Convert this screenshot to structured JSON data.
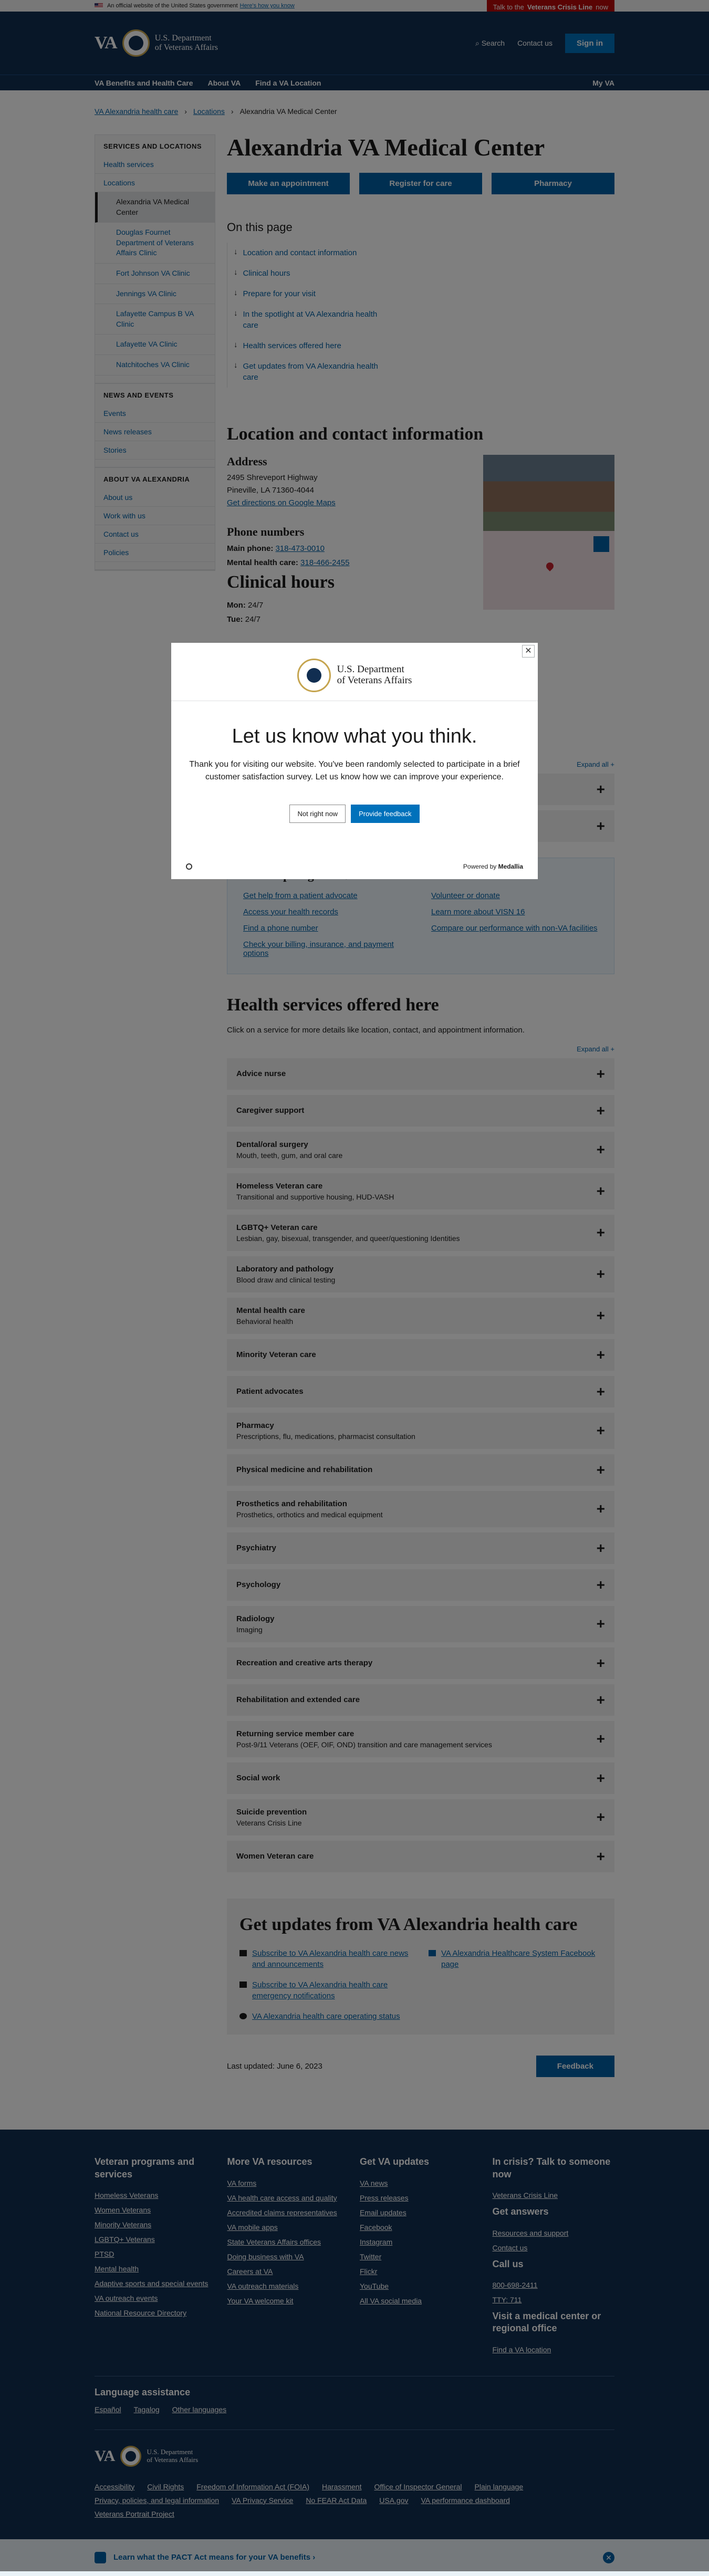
{
  "gov_banner": {
    "text": "An official website of the United States government",
    "link": "Here's how you know"
  },
  "crisis_line": {
    "prefix": "Talk to the",
    "bold": "Veterans Crisis Line",
    "suffix": "now"
  },
  "header": {
    "logo_va": "VA",
    "dept_line1": "U.S. Department",
    "dept_line2": "of Veterans Affairs",
    "search": "Search",
    "contact": "Contact us",
    "signin": "Sign in"
  },
  "megamenu": [
    "VA Benefits and Health Care",
    "About VA",
    "Find a VA Location"
  ],
  "megamenu_right": "My VA",
  "breadcrumb": [
    "VA Alexandria health care",
    "Locations",
    "Alexandria VA Medical Center"
  ],
  "sidenav": {
    "sec1": "SERVICES AND LOCATIONS",
    "sec1_items": [
      "Health services",
      "Locations"
    ],
    "locations": [
      "Alexandria VA Medical Center",
      "Douglas Fournet Department of Veterans Affairs Clinic",
      "Fort Johnson VA Clinic",
      "Jennings VA Clinic",
      "Lafayette Campus B VA Clinic",
      "Lafayette VA Clinic",
      "Natchitoches VA Clinic"
    ],
    "sec2": "NEWS AND EVENTS",
    "sec2_items": [
      "Events",
      "News releases",
      "Stories"
    ],
    "sec3": "ABOUT VA ALEXANDRIA",
    "sec3_items": [
      "About us",
      "Work with us",
      "Contact us",
      "Policies"
    ]
  },
  "page": {
    "title": "Alexandria VA Medical Center",
    "actions": [
      "Make an appointment",
      "Register for care",
      "Pharmacy"
    ],
    "otp_title": "On this page",
    "otp": [
      "Location and contact information",
      "Clinical hours",
      "Prepare for your visit",
      "In the spotlight at VA Alexandria health care",
      "Health services offered here",
      "Get updates from VA Alexandria health care"
    ],
    "loc_title": "Location and contact information",
    "address_h": "Address",
    "address1": "2495 Shreveport Highway",
    "address2": "Pineville, LA 71360-4044",
    "directions": "Get directions on Google Maps",
    "phone_h": "Phone numbers",
    "main_phone_label": "Main phone:",
    "main_phone": "318-473-0010",
    "mh_label": "Mental health care:",
    "mh_phone": "318-466-2455",
    "hours_title": "Clinical hours",
    "hours": [
      {
        "d": "Mon:",
        "h": "24/7"
      },
      {
        "d": "Tue:",
        "h": "24/7"
      }
    ],
    "expand_all": "Expand all +",
    "spotlight_title": "In the spotlight at VA Alexandria health care",
    "spotlight": [
      "Get help from a patient advocate",
      "Volunteer or donate",
      "Access your health records",
      "Learn more about VISN 16",
      "Find a phone number",
      "Compare our performance with non-VA facilities",
      "Check your billing, insurance, and payment options"
    ],
    "hs_title": "Health services offered here",
    "hs_intro": "Click on a service for more details like location, contact, and appointment information.",
    "services": [
      {
        "t": "Advice nurse",
        "s": ""
      },
      {
        "t": "Caregiver support",
        "s": ""
      },
      {
        "t": "Dental/oral surgery",
        "s": "Mouth, teeth, gum, and oral care"
      },
      {
        "t": "Homeless Veteran care",
        "s": "Transitional and supportive housing, HUD-VASH"
      },
      {
        "t": "LGBTQ+ Veteran care",
        "s": "Lesbian, gay, bisexual, transgender, and queer/questioning Identities"
      },
      {
        "t": "Laboratory and pathology",
        "s": "Blood draw and clinical testing"
      },
      {
        "t": "Mental health care",
        "s": "Behavioral health"
      },
      {
        "t": "Minority Veteran care",
        "s": ""
      },
      {
        "t": "Patient advocates",
        "s": ""
      },
      {
        "t": "Pharmacy",
        "s": "Prescriptions, flu, medications, pharmacist consultation"
      },
      {
        "t": "Physical medicine and rehabilitation",
        "s": ""
      },
      {
        "t": "Prosthetics and rehabilitation",
        "s": "Prosthetics, orthotics and medical equipment"
      },
      {
        "t": "Psychiatry",
        "s": ""
      },
      {
        "t": "Psychology",
        "s": ""
      },
      {
        "t": "Radiology",
        "s": "Imaging"
      },
      {
        "t": "Recreation and creative arts therapy",
        "s": ""
      },
      {
        "t": "Rehabilitation and extended care",
        "s": ""
      },
      {
        "t": "Returning service member care",
        "s": "Post-9/11 Veterans (OEF, OIF, OND) transition and care management services"
      },
      {
        "t": "Social work",
        "s": ""
      },
      {
        "t": "Suicide prevention",
        "s": "Veterans Crisis Line"
      },
      {
        "t": "Women Veteran care",
        "s": ""
      }
    ],
    "updates_title": "Get updates from VA Alexandria health care",
    "updates": [
      "Subscribe to VA Alexandria health care news and announcements",
      "VA Alexandria Healthcare System Facebook page",
      "Subscribe to VA Alexandria health care emergency notifications",
      "",
      "VA Alexandria health care operating status"
    ],
    "last_updated": "Last updated: June 6, 2023",
    "feedback": "Feedback"
  },
  "footer": {
    "cols": [
      {
        "h": "Veteran programs and services",
        "items": [
          "Homeless Veterans",
          "Women Veterans",
          "Minority Veterans",
          "LGBTQ+ Veterans",
          "PTSD",
          "Mental health",
          "Adaptive sports and special events",
          "VA outreach events",
          "National Resource Directory"
        ]
      },
      {
        "h": "More VA resources",
        "items": [
          "VA forms",
          "VA health care access and quality",
          "Accredited claims representatives",
          "VA mobile apps",
          "State Veterans Affairs offices",
          "Doing business with VA",
          "Careers at VA",
          "VA outreach materials",
          "Your VA welcome kit"
        ]
      },
      {
        "h": "Get VA updates",
        "items": [
          "VA news",
          "Press releases",
          "Email updates",
          "Facebook",
          "Instagram",
          "Twitter",
          "Flickr",
          "YouTube",
          "All VA social media"
        ]
      },
      {
        "h": "In crisis? Talk to someone now",
        "items": [
          "Veterans Crisis Line"
        ],
        "h2": "Get answers",
        "items2": [
          "Resources and support",
          "Contact us"
        ],
        "h3": "Call us",
        "items3": [
          "800-698-2411",
          "TTY: 711"
        ],
        "h4": "Visit a medical center or regional office",
        "items4": [
          "Find a VA location"
        ]
      }
    ],
    "lang_h": "Language assistance",
    "langs": [
      "Español",
      "Tagalog",
      "Other languages"
    ],
    "links": [
      "Accessibility",
      "Civil Rights",
      "Freedom of Information Act (FOIA)",
      "Harassment",
      "Office of Inspector General",
      "Plain language",
      "Privacy, policies, and legal information",
      "VA Privacy Service",
      "No FEAR Act Data",
      "USA.gov",
      "VA performance dashboard",
      "Veterans Portrait Project"
    ]
  },
  "bottombar": "Learn what the PACT Act means for your VA benefits ›",
  "modal": {
    "dept_line1": "U.S. Department",
    "dept_line2": "of Veterans Affairs",
    "title": "Let us know what you think.",
    "body": "Thank you for visiting our website. You've been randomly selected to participate in a brief customer satisfaction survey. Let us know how we can improve your experience.",
    "no": "Not right now",
    "yes": "Provide feedback",
    "powered": "Powered by",
    "brand": "Medallia"
  }
}
